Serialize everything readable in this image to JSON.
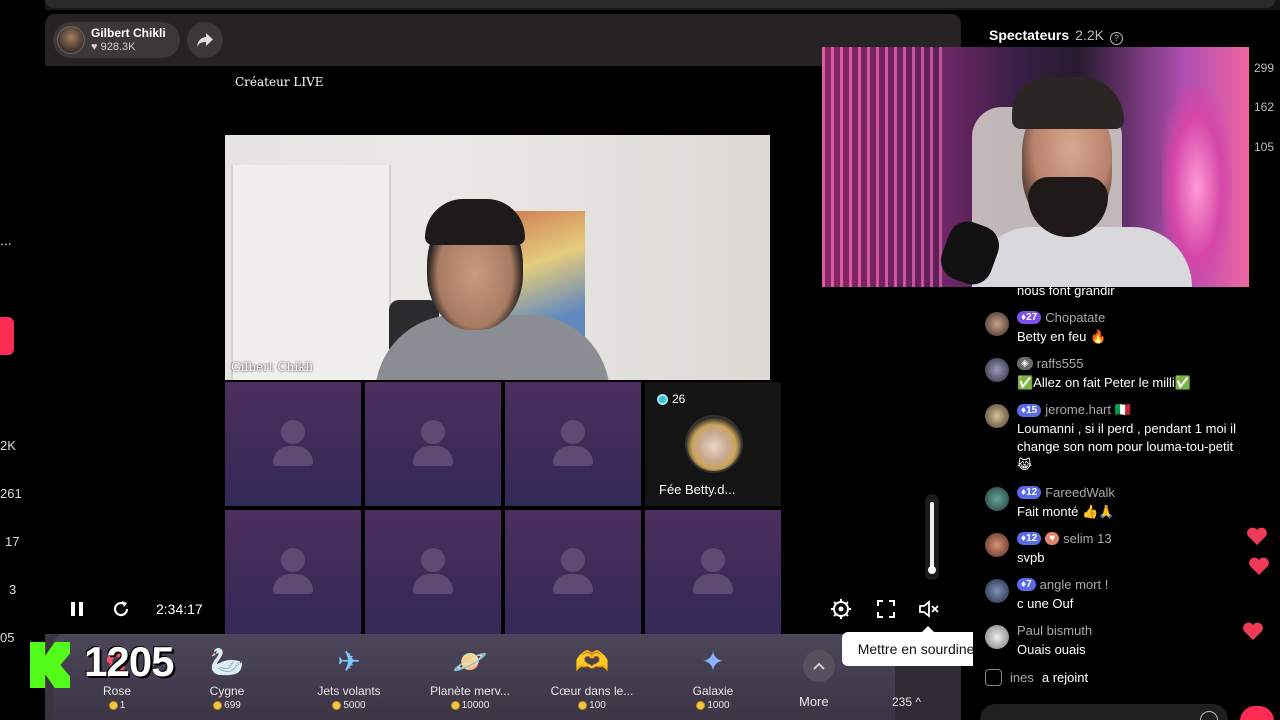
{
  "left_strip": {
    "ellipsis": "...",
    "numbers": [
      "2K",
      "261",
      "17",
      "3",
      "05"
    ]
  },
  "host": {
    "name": "Gilbert Chikli",
    "likes": "928.3K"
  },
  "stage": {
    "creator_label": "Créateur LIVE",
    "main_cam_name": "Gilbert Chikli"
  },
  "featured_guest": {
    "gems": "26",
    "name": "Fée Betty.d..."
  },
  "player": {
    "time": "2:34:17"
  },
  "kick_overlay": {
    "value": "1205"
  },
  "gifts": [
    {
      "name": "Rose",
      "price": "1",
      "icon": "rose-icon"
    },
    {
      "name": "Cygne",
      "price": "699",
      "icon": "swan-icon"
    },
    {
      "name": "Jets volants",
      "price": "5000",
      "icon": "jets-icon"
    },
    {
      "name": "Planète merv...",
      "price": "10000",
      "icon": "planet-icon"
    },
    {
      "name": "Cœur dans le...",
      "price": "100",
      "icon": "heart-hands-icon"
    },
    {
      "name": "Galaxie",
      "price": "1000",
      "icon": "galaxy-icon"
    }
  ],
  "gift_bar": {
    "more_label": "More",
    "coins": "235 ^"
  },
  "tooltip": {
    "text": "Mettre en sourdine (M)"
  },
  "spectators": {
    "label": "Spectateurs",
    "count": "2.2K",
    "side_numbers": [
      "299",
      "162",
      "105"
    ]
  },
  "chat": {
    "partial_line": "nous font grandir",
    "messages": [
      {
        "level": "27",
        "user": "Chopatate",
        "text": "Betty en feu 🔥"
      },
      {
        "level": "",
        "user": "raffs555",
        "text": "✅Allez on fait Peter le milli✅"
      },
      {
        "level": "15",
        "user": "jerome.hart 🇮🇹",
        "text": "Loumanni , si il perd , pendant 1 moi il change son nom pour louma-tou-petit 😹"
      },
      {
        "level": "12",
        "user": "FareedWalk",
        "text": "Fait monté 👍🙏"
      },
      {
        "level": "12",
        "user": "selim 13",
        "text": "svpb"
      },
      {
        "level": "7",
        "user": "angle mort !",
        "text": "c une Ouf"
      },
      {
        "level": "",
        "user": "Paul bismuth",
        "text": "Ouais ouais"
      }
    ],
    "joined": {
      "user": "ines",
      "action": "a rejoint"
    }
  },
  "colors": {
    "accent": "#fe2c55",
    "kick_green": "#53fc18",
    "gift_bar": "#3a3540",
    "guest_tile": "#3d2a58"
  }
}
